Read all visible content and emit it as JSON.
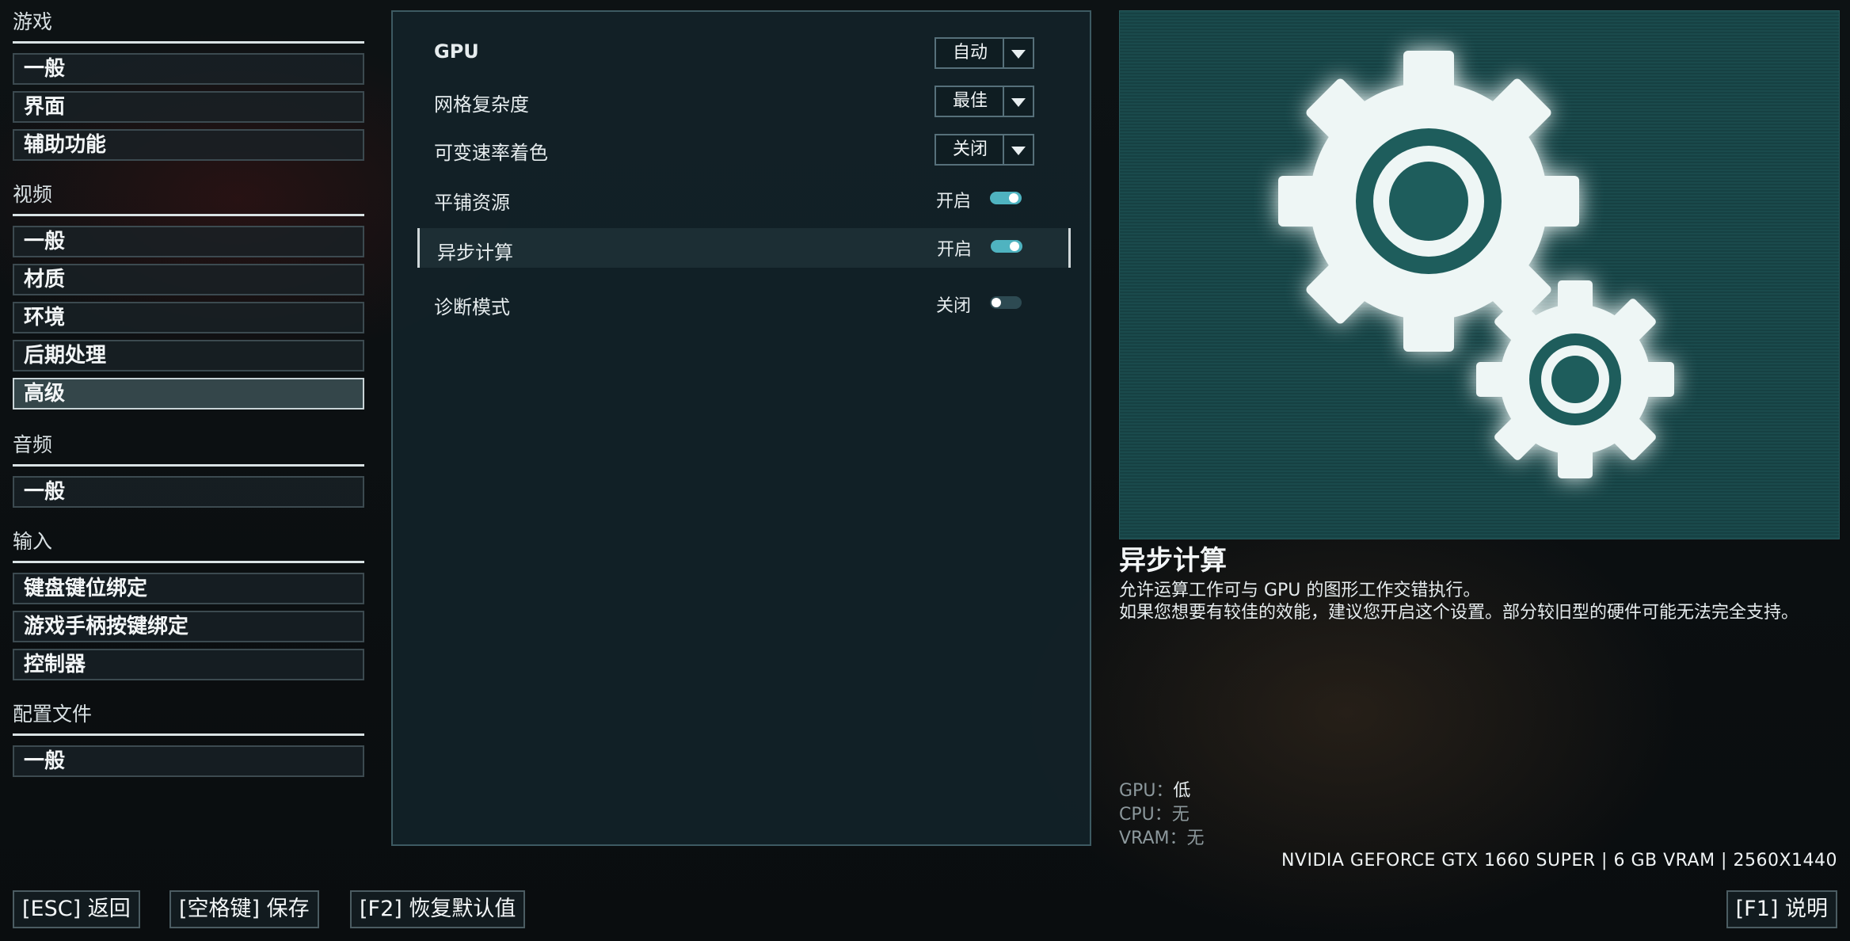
{
  "nav": {
    "sections": [
      {
        "title": "游戏",
        "items": [
          "一般",
          "界面",
          "辅助功能"
        ]
      },
      {
        "title": "视频",
        "items": [
          "一般",
          "材质",
          "环境",
          "后期处理",
          "高级"
        ]
      },
      {
        "title": "音频",
        "items": [
          "一般"
        ]
      },
      {
        "title": "输入",
        "items": [
          "键盘键位绑定",
          "游戏手柄按键绑定",
          "控制器"
        ]
      },
      {
        "title": "配置文件",
        "items": [
          "一般"
        ]
      }
    ],
    "active": "高级"
  },
  "settings": [
    {
      "label": "GPU",
      "type": "dropdown",
      "value": "自动"
    },
    {
      "label": "网格复杂度",
      "type": "dropdown",
      "value": "最佳"
    },
    {
      "label": "可变速率着色",
      "type": "dropdown",
      "value": "关闭"
    },
    {
      "label": "平铺资源",
      "type": "toggle",
      "value": "开启",
      "on": true
    },
    {
      "label": "异步计算",
      "type": "toggle",
      "value": "开启",
      "on": true,
      "selected": true
    },
    {
      "label": "诊断模式",
      "type": "toggle",
      "value": "关闭",
      "on": false
    }
  ],
  "info": {
    "title": "异步计算",
    "line1": "允许运算工作可与 GPU 的图形工作交错执行。",
    "line2": "如果您想要有较佳的效能，建议您开启这个设置。部分较旧型的硬件可能无法完全支持。",
    "impact": [
      {
        "key": "GPU：",
        "val": "低",
        "dim": false
      },
      {
        "key": "CPU：",
        "val": "无",
        "dim": true
      },
      {
        "key": "VRAM：",
        "val": "无",
        "dim": true
      }
    ],
    "hardware": "NVIDIA GEFORCE GTX 1660 SUPER | 6 GB VRAM | 2560X1440"
  },
  "buttons": {
    "back": "[ESC] 返回",
    "save": "[空格键] 保存",
    "defaults": "[F2] 恢复默认值",
    "help": "[F1] 说明"
  }
}
